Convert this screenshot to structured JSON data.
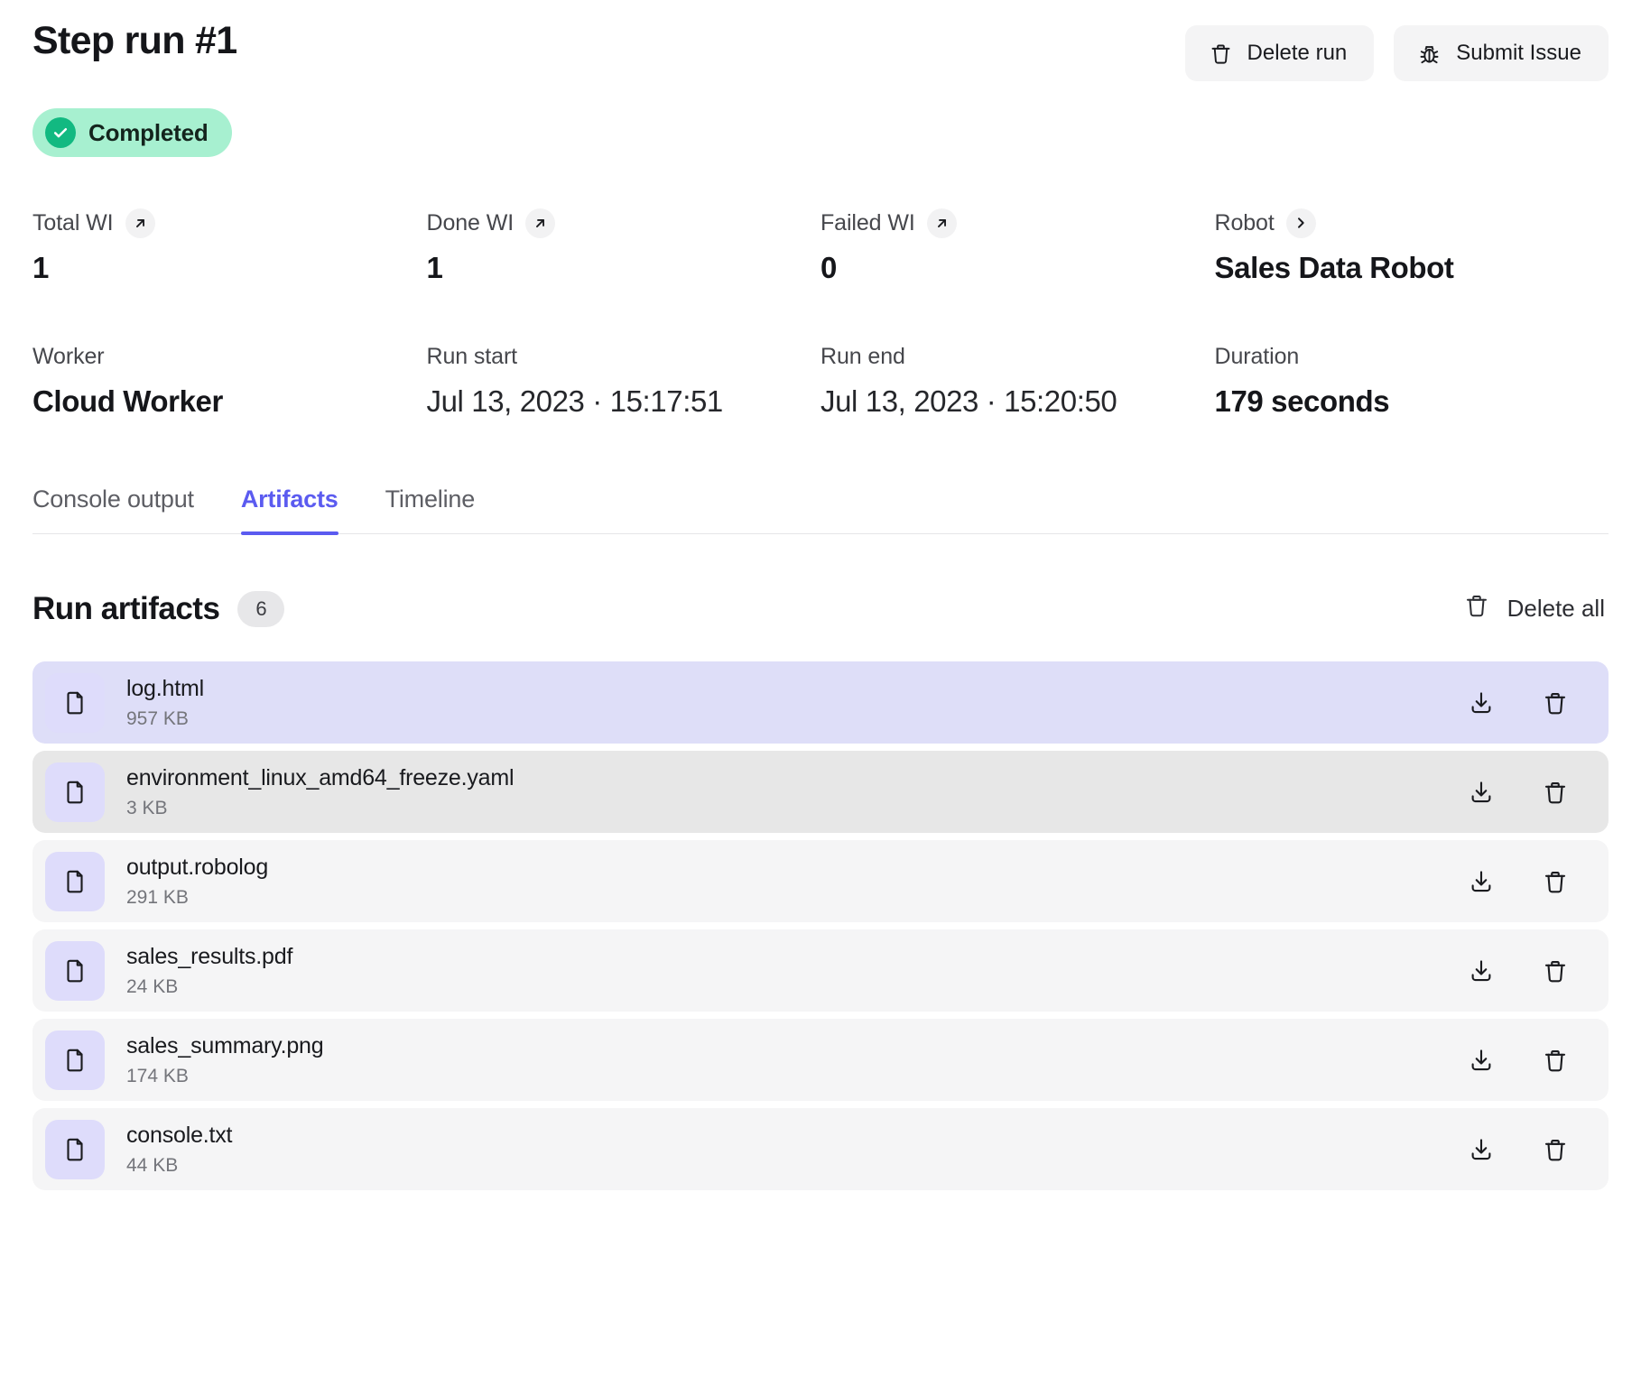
{
  "header": {
    "title": "Step run #1",
    "actions": [
      {
        "label": "Delete run",
        "icon": "trash-icon"
      },
      {
        "label": "Submit Issue",
        "icon": "bug-icon"
      }
    ]
  },
  "status": {
    "label": "Completed",
    "icon": "check-circle-icon",
    "bg_color": "#a7f0d0",
    "accent_color": "#12b981"
  },
  "stats_primary": [
    {
      "label": "Total WI",
      "value": "1",
      "icon": "arrow-up-right-icon"
    },
    {
      "label": "Done WI",
      "value": "1",
      "icon": "arrow-up-right-icon"
    },
    {
      "label": "Failed WI",
      "value": "0",
      "icon": "arrow-up-right-icon"
    },
    {
      "label": "Robot",
      "value": "Sales Data Robot",
      "icon": "chevron-right-icon"
    }
  ],
  "stats_secondary": [
    {
      "label": "Worker",
      "value": "Cloud Worker",
      "bold": true
    },
    {
      "label": "Run start",
      "value": "Jul 13, 2023 · 15:17:51",
      "bold": false
    },
    {
      "label": "Run end",
      "value": "Jul 13, 2023 · 15:20:50",
      "bold": false
    },
    {
      "label": "Duration",
      "value": "179 seconds",
      "bold": true
    }
  ],
  "tabs": [
    {
      "label": "Console output",
      "active": false
    },
    {
      "label": "Artifacts",
      "active": true
    },
    {
      "label": "Timeline",
      "active": false
    }
  ],
  "artifacts_section": {
    "title": "Run artifacts",
    "count": "6",
    "delete_all_label": "Delete all",
    "delete_all_icon": "trash-icon",
    "accent_color": "#5b5bf0"
  },
  "artifacts": [
    {
      "name": "log.html",
      "size": "957 KB",
      "state": "state-selected",
      "icon": "file-icon"
    },
    {
      "name": "environment_linux_amd64_freeze.yaml",
      "size": "3 KB",
      "state": "state-hover",
      "icon": "file-icon"
    },
    {
      "name": "output.robolog",
      "size": "291 KB",
      "state": "state-default",
      "icon": "file-icon"
    },
    {
      "name": "sales_results.pdf",
      "size": "24 KB",
      "state": "state-default",
      "icon": "file-icon"
    },
    {
      "name": "sales_summary.png",
      "size": "174 KB",
      "state": "state-default",
      "icon": "file-icon"
    },
    {
      "name": "console.txt",
      "size": "44 KB",
      "state": "state-default",
      "icon": "file-icon"
    }
  ],
  "row_actions": {
    "download_icon": "download-icon",
    "delete_icon": "trash-icon"
  }
}
